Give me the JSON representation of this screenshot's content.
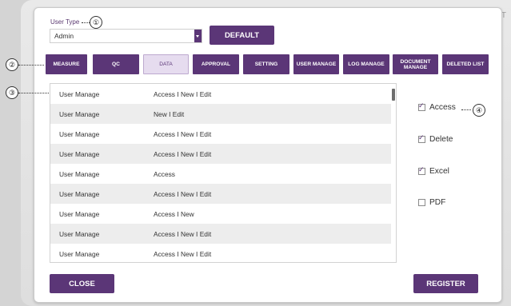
{
  "app": {
    "title": "T"
  },
  "footer": {
    "text": ""
  },
  "user_type": {
    "label": "User Type",
    "value": "Admin"
  },
  "default_button": "DEFAULT",
  "tabs": [
    {
      "label": "MEASURE",
      "active": false
    },
    {
      "label": "QC",
      "active": false
    },
    {
      "label": "DATA",
      "active": true
    },
    {
      "label": "APPROVAL",
      "active": false
    },
    {
      "label": "SETTING",
      "active": false
    },
    {
      "label": "USER MANAGE",
      "active": false
    },
    {
      "label": "LOG MANAGE",
      "active": false
    },
    {
      "label": "DOCUMENT MANAGE",
      "active": false
    },
    {
      "label": "DELETED LIST",
      "active": false
    }
  ],
  "permissions": [
    {
      "name": "User Manage",
      "perm": "Access I New I Edit"
    },
    {
      "name": "User Manage",
      "perm": "New I Edit"
    },
    {
      "name": "User Manage",
      "perm": "Access I New I Edit"
    },
    {
      "name": "User Manage",
      "perm": "Access I New I Edit"
    },
    {
      "name": "User Manage",
      "perm": "Access"
    },
    {
      "name": "User Manage",
      "perm": "Access I New I Edit"
    },
    {
      "name": "User Manage",
      "perm": "Access I New"
    },
    {
      "name": "User Manage",
      "perm": "Access I New I Edit"
    },
    {
      "name": "User Manage",
      "perm": "Access I New I Edit"
    }
  ],
  "options": [
    {
      "label": "Access",
      "checked": true
    },
    {
      "label": "Delete",
      "checked": true
    },
    {
      "label": "Excel",
      "checked": true
    },
    {
      "label": "PDF",
      "checked": false
    }
  ],
  "close_button": "CLOSE",
  "register_button": "REGISTER",
  "callouts": [
    "①",
    "②",
    "③",
    "④"
  ]
}
